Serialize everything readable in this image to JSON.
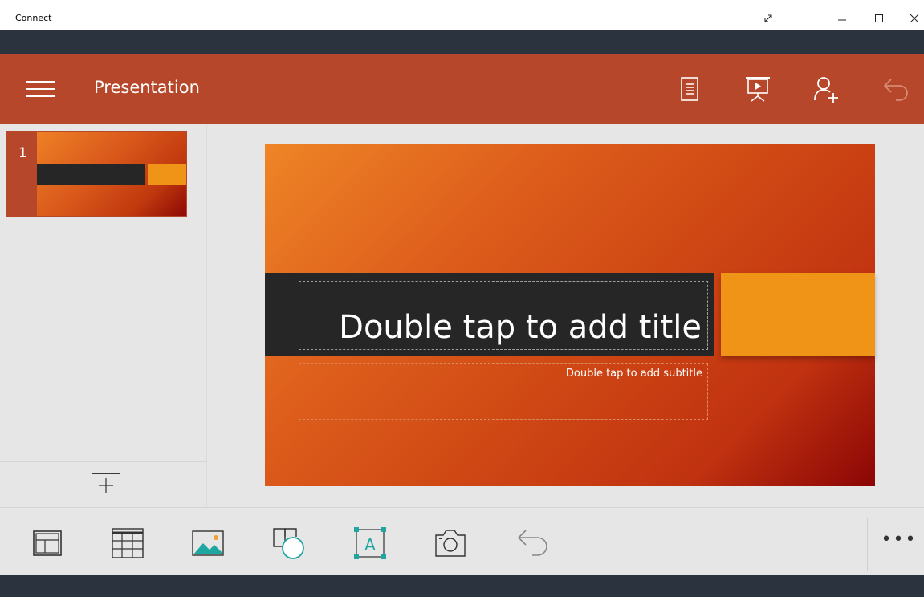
{
  "window": {
    "title": "Connect"
  },
  "header": {
    "title": "Presentation",
    "icons": [
      "menu-icon",
      "notes-icon",
      "present-icon",
      "share-user-icon",
      "undo-icon"
    ],
    "accent_color": "#b7472a"
  },
  "thumbnails": [
    {
      "number": "1"
    }
  ],
  "slide": {
    "title_placeholder": "Double tap to add title",
    "subtitle_placeholder": "Double tap to add subtitle"
  },
  "toolbar": {
    "tools": [
      "layout-icon",
      "table-icon",
      "picture-icon",
      "shapes-icon",
      "textbox-icon",
      "camera-icon",
      "undo-icon"
    ],
    "more_label": "•••"
  }
}
